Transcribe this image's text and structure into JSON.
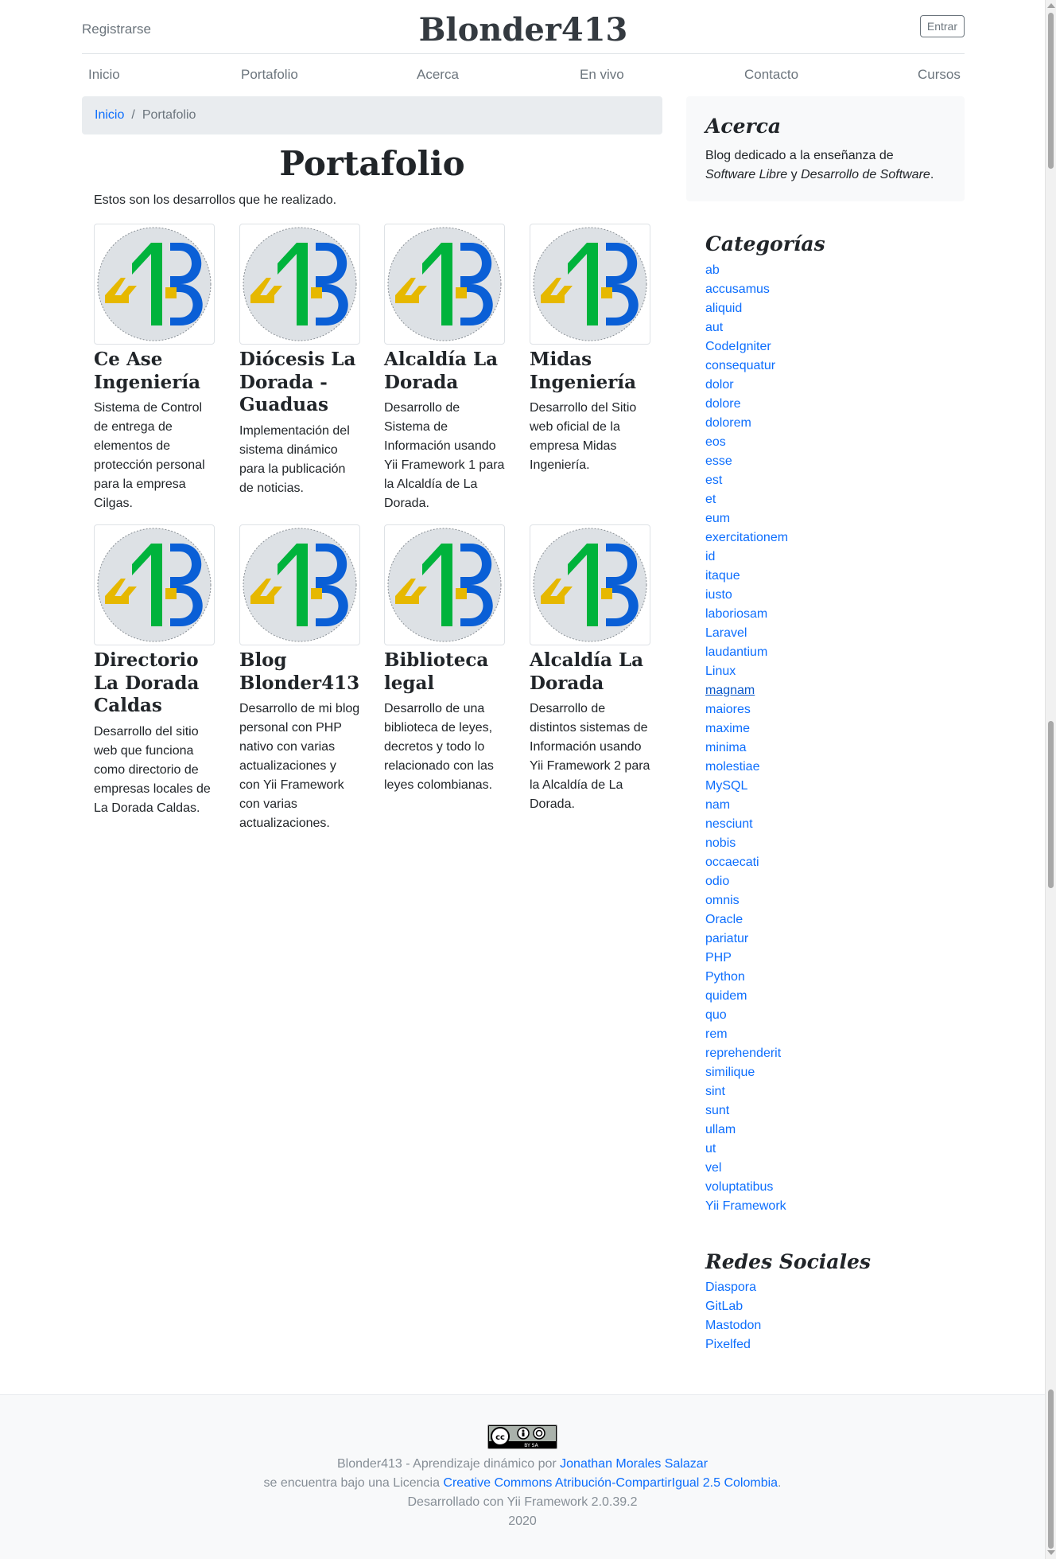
{
  "header": {
    "register": "Registrarse",
    "brand": "Blonder413",
    "login": "Entrar"
  },
  "nav": [
    "Inicio",
    "Portafolio",
    "Acerca",
    "En vivo",
    "Contacto",
    "Cursos"
  ],
  "breadcrumb": {
    "home": "Inicio",
    "separator": "/",
    "current": "Portafolio"
  },
  "main": {
    "title": "Portafolio",
    "intro": "Estos son los desarrollos que he realizado.",
    "projects": [
      {
        "title": "Ce Ase Ingeniería",
        "desc": "Sistema de Control de entrega de elementos de protección personal para la empresa Cilgas."
      },
      {
        "title": "Diócesis La Dorada - Guaduas",
        "desc": "Implementación del sistema dinámico para la publicación de noticias."
      },
      {
        "title": "Alcaldía La Dorada",
        "desc": "Desarrollo de Sistema de Información usando Yii Framework 1 para la Alcaldía de La Dorada."
      },
      {
        "title": "Midas Ingeniería",
        "desc": "Desarrollo del Sitio web oficial de la empresa Midas Ingeniería."
      },
      {
        "title": "Directorio La Dorada Caldas",
        "desc": "Desarrollo del sitio web que funciona como directorio de empresas locales de La Dorada Caldas."
      },
      {
        "title": "Blog Blonder413",
        "desc": "Desarrollo de mi blog personal con PHP nativo con varias actualizaciones y con Yii Framework con varias actualizaciones."
      },
      {
        "title": "Biblioteca legal",
        "desc": "Desarrollo de una biblioteca de leyes, decretos y todo lo relacionado con las leyes colombianas."
      },
      {
        "title": "Alcaldía La Dorada",
        "desc": "Desarrollo de distintos sistemas de Información usando Yii Framework 2 para la Alcaldía de La Dorada."
      }
    ],
    "logo_colors": {
      "four": "#e6b800",
      "one": "#00b33c",
      "three": "#0a5fd6",
      "circle": "#dde1e5"
    }
  },
  "sidebar": {
    "about": {
      "title": "Acerca",
      "text_before": "Blog dedicado a la enseñanza de ",
      "em1": "Software Libre",
      "mid": " y ",
      "em2": "Desarrollo de Software",
      "end": "."
    },
    "categories_title": "Categorías",
    "categories": [
      "ab",
      "accusamus",
      "aliquid",
      "aut",
      "CodeIgniter",
      "consequatur",
      "dolor",
      "dolore",
      "dolorem",
      "eos",
      "esse",
      "est",
      "et",
      "eum",
      "exercitationem",
      "id",
      "itaque",
      "iusto",
      "laboriosam",
      "Laravel",
      "laudantium",
      "Linux",
      "magnam",
      "maiores",
      "maxime",
      "minima",
      "molestiae",
      "MySQL",
      "nam",
      "nesciunt",
      "nobis",
      "occaecati",
      "odio",
      "omnis",
      "Oracle",
      "pariatur",
      "PHP",
      "Python",
      "quidem",
      "quo",
      "rem",
      "reprehenderit",
      "similique",
      "sint",
      "sunt",
      "ullam",
      "ut",
      "vel",
      "voluptatibus",
      "Yii Framework"
    ],
    "hovered_category": "magnam",
    "social_title": "Redes Sociales",
    "social": [
      "Diaspora",
      "GitLab",
      "Mastodon",
      "Pixelfed"
    ]
  },
  "footer": {
    "license_badge": "BY SA",
    "line1_prefix": "Blonder413 - Aprendizaje dinámico por ",
    "author": "Jonathan Morales Salazar",
    "line2_prefix": "se encuentra bajo una Licencia ",
    "license": "Creative Commons Atribución-CompartirIgual 2.5 Colombia",
    "line2_suffix": ".",
    "line3": "Desarrollado con Yii Framework 2.0.39.2",
    "year": "2020"
  },
  "colors": {
    "link": "#0d6efd",
    "muted": "#6c757d",
    "breadcrumb_bg": "#e9ecef",
    "footer_bg": "#f8f9fa"
  }
}
